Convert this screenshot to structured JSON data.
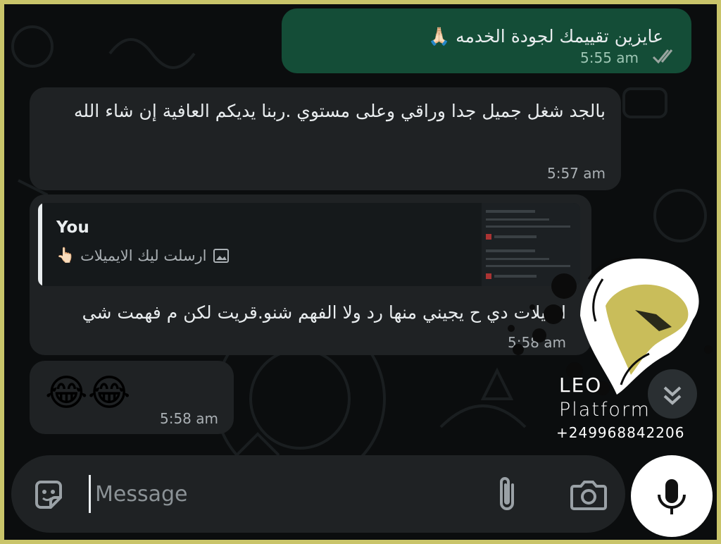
{
  "colors": {
    "outgoing_bubble": "#144d37",
    "incoming_bubble": "#1f2224",
    "background": "#0b0d0e",
    "frame": "#c9c46a",
    "watermark_gold": "#c9bd5a"
  },
  "messages": [
    {
      "direction": "outgoing",
      "text": "عايزين تقييمك لجودة الخدمه 🙏🏻",
      "time": "5:55 am",
      "status_icon": "double-check-icon"
    },
    {
      "direction": "incoming",
      "text": "بالجد شغل جميل جدا وراقي وعلى مستوي .ربنا يديكم العافية إن شاء الله",
      "time": "5:57 am"
    },
    {
      "direction": "incoming",
      "quote": {
        "author": "You",
        "icon": "image-icon",
        "text": "ارسلت ليك الايميلات",
        "emoji": "👆🏻"
      },
      "text": "ايميلات دي ح يجيني منها رد ولا الفهم شنو.قريت لكن م فهمت شي",
      "time": "5:58 am"
    },
    {
      "direction": "incoming",
      "text": "😂😂",
      "time": "5:58 am"
    }
  ],
  "composer": {
    "placeholder": "Message",
    "left_icon": "sticker-icon",
    "right_icons": [
      "paperclip-icon",
      "camera-icon"
    ],
    "send_icon": "microphone-icon"
  },
  "scroll_button_icon": "double-chevron-down-icon",
  "watermark": {
    "brand": "LEO",
    "subtitle": "Platform",
    "phone": "+249968842206",
    "icon": "lion-logo-icon"
  }
}
